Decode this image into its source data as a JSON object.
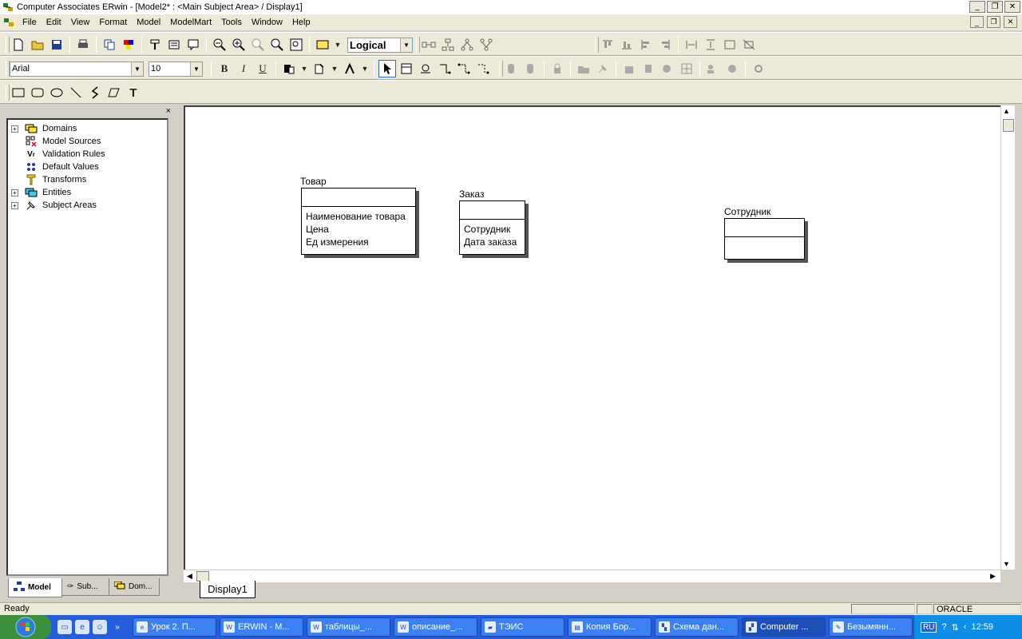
{
  "window": {
    "title": "Computer Associates ERwin - [Model2* : <Main Subject Area> / Display1]",
    "buttons": [
      "_",
      "❐",
      "✕"
    ]
  },
  "menubar": {
    "items": [
      "File",
      "Edit",
      "View",
      "Format",
      "Model",
      "ModelMart",
      "Tools",
      "Window",
      "Help"
    ],
    "mdi_buttons": [
      "_",
      "❐",
      "✕"
    ]
  },
  "toolbar": {
    "model_level": "Logical",
    "font_name": "Arial",
    "font_size": "10",
    "bold": "B",
    "italic": "I",
    "underline": "U",
    "text_tool": "T"
  },
  "panel": {
    "close": "×",
    "tree": [
      {
        "label": "Domains",
        "expander": "+",
        "icon": "domains-icon"
      },
      {
        "label": "Model Sources",
        "expander": "",
        "icon": "model-sources-icon"
      },
      {
        "label": "Validation Rules",
        "expander": "",
        "icon": "validation-rules-icon"
      },
      {
        "label": "Default Values",
        "expander": "",
        "icon": "default-values-icon"
      },
      {
        "label": "Transforms",
        "expander": "",
        "icon": "transforms-icon"
      },
      {
        "label": "Entities",
        "expander": "+",
        "icon": "entities-icon"
      },
      {
        "label": "Subject Areas",
        "expander": "+",
        "icon": "subject-areas-icon"
      }
    ],
    "tabs": [
      "Model",
      "Sub...",
      "Dom..."
    ]
  },
  "diagram": {
    "tab": "Display1",
    "entities": [
      {
        "name": "Товар",
        "attributes": [
          "Наименование товара",
          "Цена",
          "Ед измерения"
        ]
      },
      {
        "name": "Заказ",
        "attributes": [
          "Сотрудник",
          "Дата заказа"
        ]
      },
      {
        "name": "Сотрудник",
        "attributes": []
      }
    ]
  },
  "statusbar": {
    "text": "Ready",
    "db": "ORACLE"
  },
  "taskbar": {
    "tasks": [
      "Урок 2. П...",
      "ERWIN - M...",
      "таблицы_...",
      "описание_...",
      "ТЭИС",
      "Копия Бор...",
      "Схема дан...",
      "Computer ...",
      "Безымянн..."
    ],
    "active_index": 7,
    "lang": "RU",
    "clock": "12:59"
  },
  "colors": {
    "titlebar_bg": "#ffffff",
    "chrome_bg": "#ece9d8",
    "taskbar_bg": "#245edb",
    "canvas_bg": "#ffffff"
  }
}
